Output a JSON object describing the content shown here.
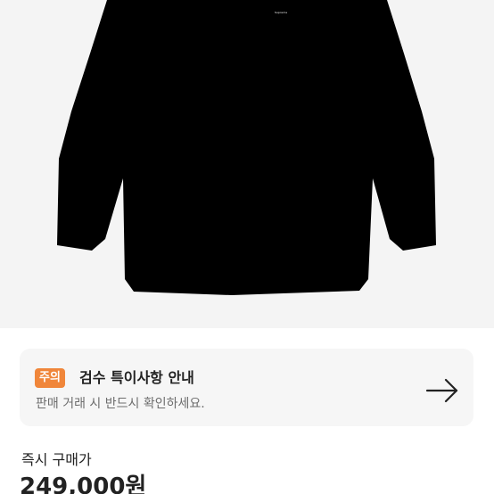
{
  "product": {
    "image_label": "Supreme",
    "colors": {
      "background": "#f4f4f4",
      "garment": "#000000"
    }
  },
  "notice": {
    "badge": "주의",
    "title": "검수 특이사항 안내",
    "description": "판매 거래 시 반드시 확인하세요.",
    "icon": "arrow-right-icon",
    "colors": {
      "badge": "#f0863a",
      "card": "#f6f6f6"
    }
  },
  "price": {
    "label": "즉시 구매가",
    "value": "249,000원"
  }
}
